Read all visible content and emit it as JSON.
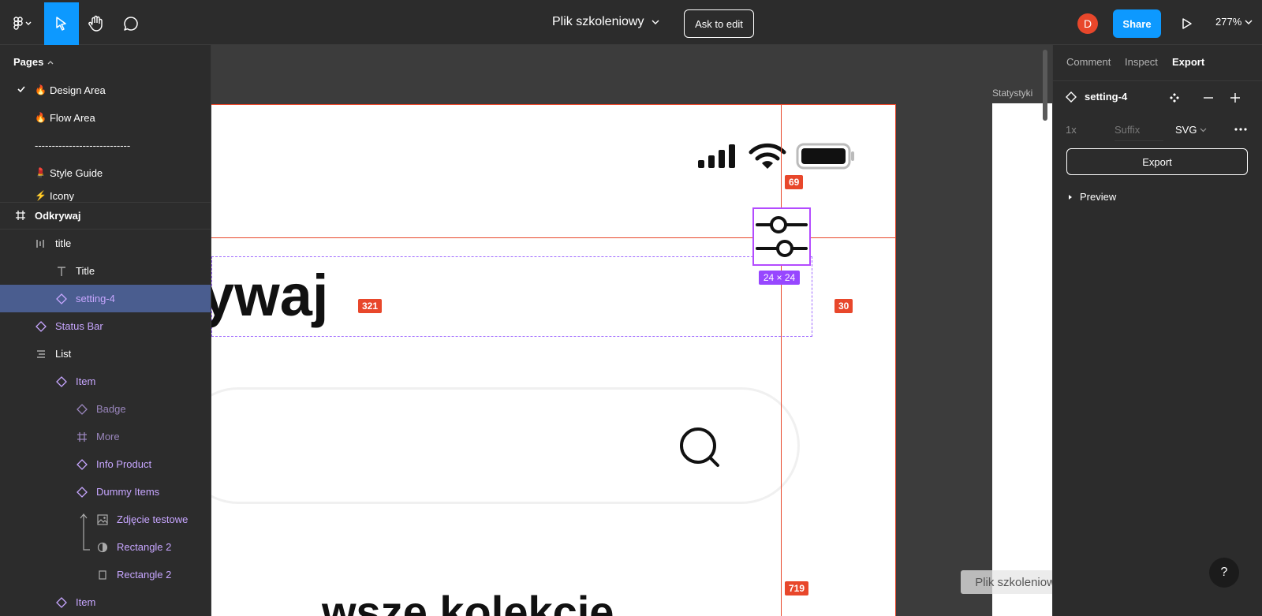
{
  "toolbar": {
    "file_title": "Plik szkoleniowy",
    "ask_to_edit": "Ask to edit",
    "avatar_initial": "D",
    "share": "Share",
    "zoom": "277%"
  },
  "pages": {
    "header": "Pages",
    "items": [
      {
        "label": "Design Area",
        "emoji": "🔥",
        "checked": true
      },
      {
        "label": "Flow Area",
        "emoji": "🔥"
      },
      {
        "label": "----------------------------"
      },
      {
        "label": "Style Guide",
        "emoji": "💄"
      },
      {
        "label": "Icony",
        "emoji": "⚡"
      }
    ]
  },
  "layers": {
    "frame": "Odkrywaj",
    "items": [
      {
        "label": "title",
        "icon": "auto-layout-icon"
      },
      {
        "label": "Title",
        "icon": "text-icon"
      },
      {
        "label": "setting-4",
        "icon": "component-instance-icon"
      },
      {
        "label": "Status Bar",
        "icon": "component-instance-icon"
      },
      {
        "label": "List",
        "icon": "list-layout-icon"
      },
      {
        "label": "Item",
        "icon": "component-instance-icon"
      },
      {
        "label": "Badge",
        "icon": "component-instance-icon"
      },
      {
        "label": "More",
        "icon": "frame-icon"
      },
      {
        "label": "Info Product",
        "icon": "component-instance-icon"
      },
      {
        "label": "Dummy Items",
        "icon": "component-instance-icon"
      },
      {
        "label": "Zdjęcie testowe",
        "icon": "image-icon"
      },
      {
        "label": "Rectangle 2",
        "icon": "mask-icon"
      },
      {
        "label": "Rectangle 2",
        "icon": "rectangle-icon"
      },
      {
        "label": "Item",
        "icon": "component-instance-icon"
      }
    ]
  },
  "canvas": {
    "side_frame_label": "Statystyki",
    "title_fragment": "ywaj",
    "bottom_text_fragment": "wsze kolekcje",
    "size_badge": "24 × 24",
    "measure_top": "69",
    "measure_left": "321",
    "measure_right": "30",
    "measure_bottom": "719",
    "tooltip": "Plik szkoleniowy – Figma"
  },
  "right_panel": {
    "tabs": [
      "Comment",
      "Inspect",
      "Export"
    ],
    "active_tab": "Export",
    "layer_name": "setting-4",
    "scale": "1x",
    "suffix_placeholder": "Suffix",
    "format": "SVG",
    "export_button": "Export",
    "preview": "Preview",
    "help": "?"
  },
  "colors": {
    "accent": "#0d99ff",
    "measure": "#e8472b",
    "component": "#c7a6ff",
    "selection": "#9747ff"
  }
}
